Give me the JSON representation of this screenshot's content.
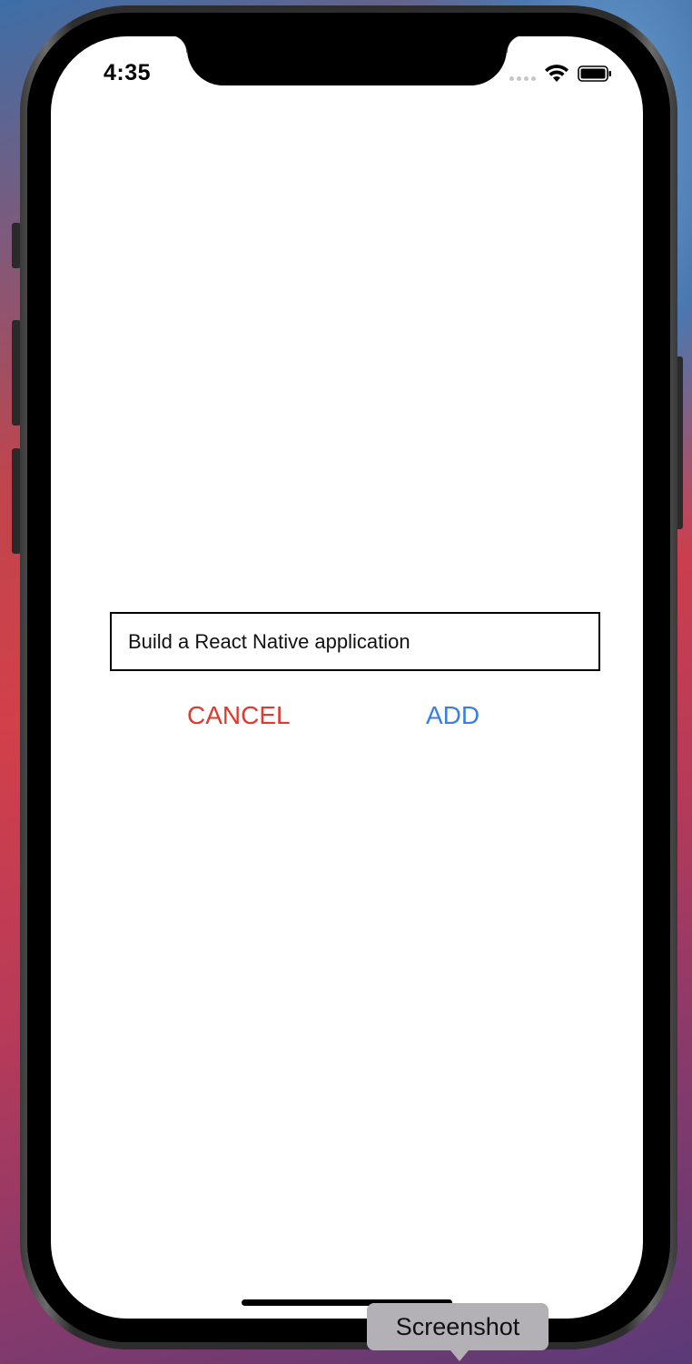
{
  "status_bar": {
    "time": "4:35",
    "wifi_icon": "wifi-icon",
    "battery_icon": "battery-icon",
    "signal_icon": "cellular-signal-icon"
  },
  "modal": {
    "input_value": "Build a React Native application",
    "cancel_label": "CANCEL",
    "add_label": "ADD",
    "cancel_color": "#de3a2e",
    "add_color": "#3a7fe0"
  },
  "simulator": {
    "tooltip_label": "Screenshot"
  }
}
